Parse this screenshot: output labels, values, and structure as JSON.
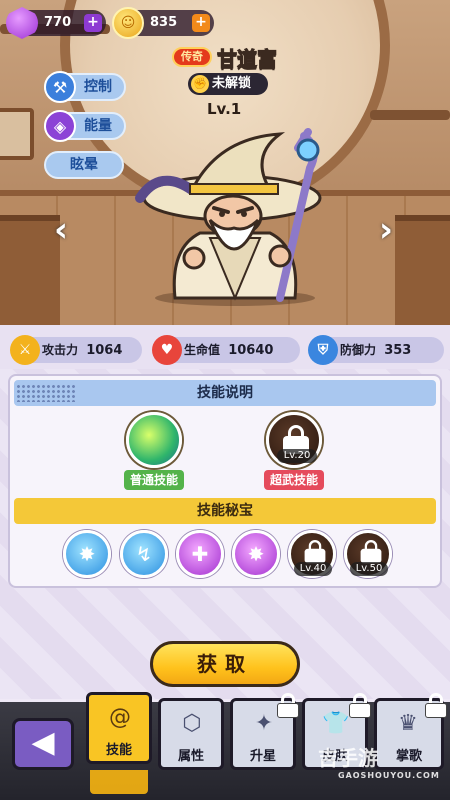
{
  "currency": {
    "gems": "770",
    "coins": "835",
    "plus": "+"
  },
  "hero": {
    "rarity": "传奇",
    "name": "甘道富",
    "status": "未解锁",
    "level": "Lv.1"
  },
  "traits": [
    "控制",
    "能量",
    "眩晕"
  ],
  "nav_arrows": {
    "left": "‹",
    "right": "›"
  },
  "stats": [
    {
      "label": "攻击力",
      "value": "1064"
    },
    {
      "label": "生命值",
      "value": "10640"
    },
    {
      "label": "防御力",
      "value": "353"
    }
  ],
  "skills_section": {
    "title": "技能说明",
    "skills": [
      {
        "tag": "普通技能"
      },
      {
        "tag": "超武技能",
        "level": "Lv.20"
      }
    ]
  },
  "treasure_section": {
    "title": "技能秘宝",
    "locked_levels": [
      "Lv.40",
      "Lv.50"
    ]
  },
  "acquire_button": "获取",
  "back_icon": "◀",
  "tabs": [
    {
      "label": "技能",
      "icon": "spiral-icon",
      "active": true
    },
    {
      "label": "属性",
      "icon": "hexagon-icon"
    },
    {
      "label": "升星",
      "icon": "star-up-icon"
    },
    {
      "label": "皮肤",
      "icon": "shirt-icon"
    },
    {
      "label": "掌歌",
      "icon": "trophy-icon"
    }
  ],
  "watermark": {
    "name": "吉手游",
    "url": "GAOSHOUYOU.COM"
  }
}
